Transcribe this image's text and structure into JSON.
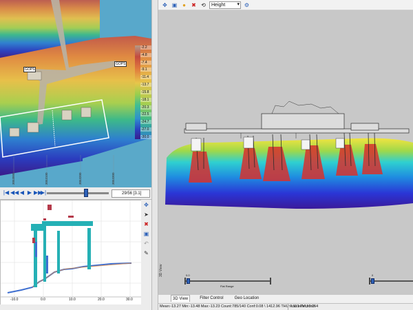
{
  "map": {
    "labels": {
      "gps_left": "GOPS",
      "gps_right": "GOPS"
    },
    "legend_ticks": [
      "-2.2",
      "-4.8",
      "-7.4",
      "-9.1",
      "-11.4",
      "-13.7",
      "-15.8",
      "-18.1",
      "-20.3",
      "-22.5",
      "-24.7",
      "-27.0",
      "-30.0"
    ],
    "axis_numbers": [
      "3053000",
      "3053100",
      "3053200",
      "3053300"
    ]
  },
  "playback": {
    "frame_field": "29/56 [3.1]",
    "buttons": [
      "|◀",
      "◀◀",
      "◀",
      "▶",
      "▶▶",
      "▶|"
    ]
  },
  "profile": {
    "x_ticks": [
      "-10.0",
      "0.0",
      "10.0",
      "20.0",
      "30.0"
    ]
  },
  "toolbar": {
    "view_mode": "Height"
  },
  "view3d": {
    "side_label": "3D View",
    "slider_caption": "Flat Range",
    "slider_left_value": "0.0",
    "slider_right_value": "0"
  },
  "tabs": [
    "3D View",
    "Filter Control",
    "Geo Location"
  ],
  "status": {
    "stats": "Mean:-13.27 Min:-13.48 Max:-13.23 Count:785/140 Conf:0.08 \\ 1412.96 THU:0.119 TVU:0.254",
    "selection": "<no selection>"
  }
}
